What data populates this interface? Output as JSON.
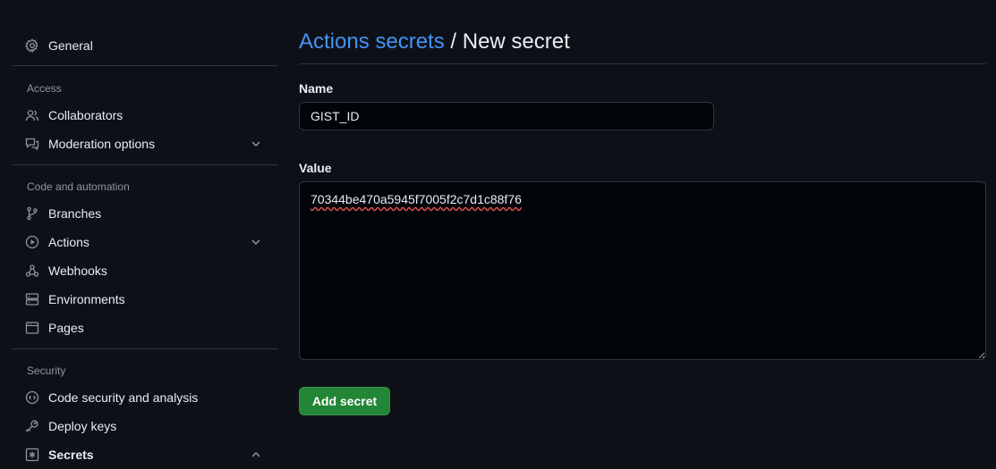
{
  "sidebar": {
    "general": {
      "label": "General",
      "icon": "gear-icon"
    },
    "sections": {
      "access": "Access",
      "code_automation": "Code and automation",
      "security": "Security"
    },
    "items": {
      "collaborators": {
        "label": "Collaborators",
        "icon": "people-icon"
      },
      "moderation": {
        "label": "Moderation options",
        "icon": "report-icon",
        "expanded": false
      },
      "branches": {
        "label": "Branches",
        "icon": "git-branch-icon"
      },
      "actions": {
        "label": "Actions",
        "icon": "play-icon",
        "expanded": false
      },
      "webhooks": {
        "label": "Webhooks",
        "icon": "webhook-icon"
      },
      "environments": {
        "label": "Environments",
        "icon": "server-icon"
      },
      "pages": {
        "label": "Pages",
        "icon": "browser-icon"
      },
      "code_security": {
        "label": "Code security and analysis",
        "icon": "codescan-icon"
      },
      "deploy_keys": {
        "label": "Deploy keys",
        "icon": "key-icon"
      },
      "secrets": {
        "label": "Secrets",
        "icon": "asterisk-icon",
        "expanded": true,
        "active": true
      }
    }
  },
  "header": {
    "breadcrumb_link": "Actions secrets",
    "separator": "/",
    "current": "New secret"
  },
  "form": {
    "name_label": "Name",
    "name_value": "GIST_ID",
    "value_label": "Value",
    "value_text": "70344be470a5945f7005f2c7d1c88f76",
    "submit_label": "Add secret"
  },
  "colors": {
    "background": "#0d1117",
    "link": "#4493f8",
    "primary_button": "#238636",
    "border": "#30363d",
    "muted_text": "#8d96a0"
  }
}
